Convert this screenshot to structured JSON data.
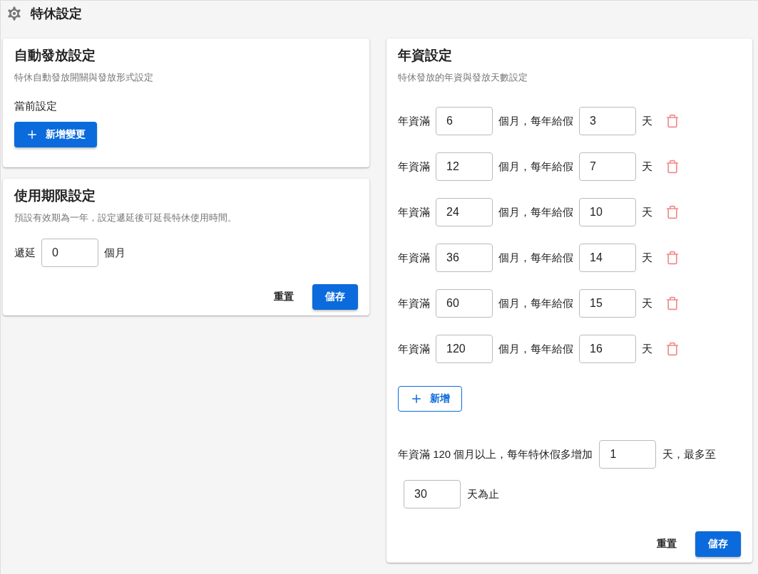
{
  "page": {
    "title": "特休設定"
  },
  "auto_issue": {
    "title": "自動發放設定",
    "description": "特休自動發放開關與發放形式設定",
    "current_label": "當前設定",
    "add_button": "新增變更"
  },
  "expiry": {
    "title": "使用期限設定",
    "description": "預設有效期為一年，設定遞延後可延長特休使用時間。",
    "defer_label": "遞延",
    "defer_value": "0",
    "unit": "個月",
    "reset_button": "重置",
    "save_button": "儲存"
  },
  "seniority": {
    "title": "年資設定",
    "description": "特休發放的年資與發放天數設定",
    "rows": [
      {
        "prefix": "年資滿",
        "months": "6",
        "middle": "個月，每年給假",
        "days": "3",
        "suffix": "天"
      },
      {
        "prefix": "年資滿",
        "months": "12",
        "middle": "個月，每年給假",
        "days": "7",
        "suffix": "天"
      },
      {
        "prefix": "年資滿",
        "months": "24",
        "middle": "個月，每年給假",
        "days": "10",
        "suffix": "天"
      },
      {
        "prefix": "年資滿",
        "months": "36",
        "middle": "個月，每年給假",
        "days": "14",
        "suffix": "天"
      },
      {
        "prefix": "年資滿",
        "months": "60",
        "middle": "個月，每年給假",
        "days": "15",
        "suffix": "天"
      },
      {
        "prefix": "年資滿",
        "months": "120",
        "middle": "個月，每年給假",
        "days": "16",
        "suffix": "天"
      }
    ],
    "add_button": "新增",
    "extra": {
      "text_before": "年資滿 120 個月以上，每年特休假多增加",
      "increment": "1",
      "text_middle": "天，最多至",
      "max": "30",
      "text_after": "天為止"
    },
    "reset_button": "重置",
    "save_button": "儲存"
  }
}
